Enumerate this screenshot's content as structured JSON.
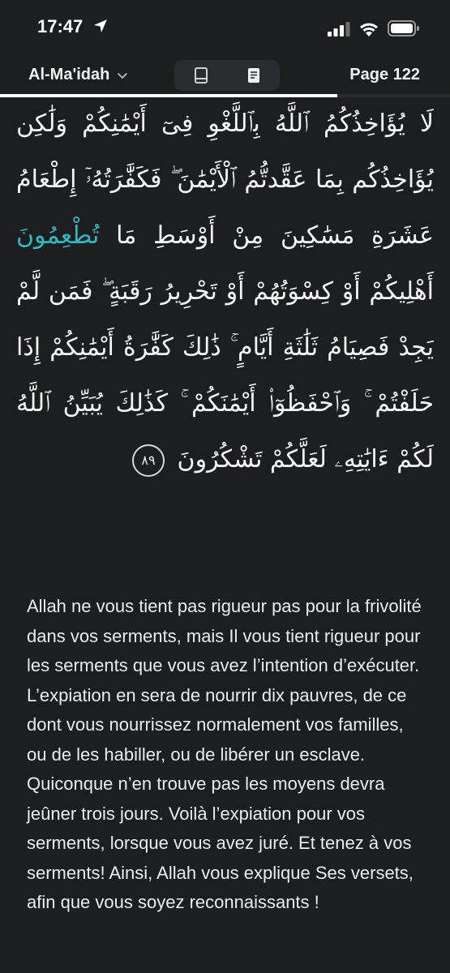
{
  "status_bar": {
    "time": "17:47"
  },
  "header": {
    "surah": "Al-Ma'idah",
    "page_label": "Page 122",
    "reading_progress": 0.75
  },
  "arabic": {
    "before_highlight": "لَا يُؤَاخِذُكُمُ ٱللَّهُ بِٱللَّغْوِ فِىٓ أَيْمَٰنِكُمْ وَلَٰكِن يُؤَاخِذُكُم بِمَا عَقَّدتُّمُ ٱلْأَيْمَٰنَ ۖ فَكَفَّٰرَتُهُۥٓ إِطْعَامُ عَشَرَةِ مَسَٰكِينَ مِنْ أَوْسَطِ مَا",
    "highlight": "تُطْعِمُونَ",
    "after_highlight": "أَهْلِيكُمْ أَوْ كِسْوَتُهُمْ أَوْ تَحْرِيرُ رَقَبَةٍ ۖ فَمَن لَّمْ يَجِدْ فَصِيَامُ ثَلَٰثَةِ أَيَّامٍ ۚ ذَٰلِكَ كَفَّٰرَةُ أَيْمَٰنِكُمْ إِذَا حَلَفْتُمْ ۚ وَٱحْفَظُوٓا۟ أَيْمَٰنَكُمْ ۚ كَذَٰلِكَ يُبَيِّنُ ٱللَّهُ لَكُمْ ءَايَٰتِهِۦ لَعَلَّكُمْ تَشْكُرُونَ",
    "ayah_number": "٨٩"
  },
  "translation": "Allah ne vous tient pas rigueur pas pour la frivolité dans vos serments, mais Il vous tient rigueur pour les serments que vous avez l’intention d’exécuter. L’expiation en sera de nourrir dix pauvres, de ce dont vous nourrissez normalement vos familles, ou de les habiller, ou de libérer un esclave. Quiconque n’en trouve pas les moyens devra jeûner trois jours. Voilà l’expiation pour vos serments, lorsque vous avez juré. Et tenez à vos serments! Ainsi, Allah vous explique Ses versets, afin que vous soyez reconnaissants !",
  "colors": {
    "background": "#1d1e20",
    "highlight": "#2eb8c0"
  },
  "icons": {
    "location": "location-arrow-icon",
    "signal": "cellular-signal-icon",
    "wifi": "wifi-icon",
    "battery": "battery-icon",
    "dropdown": "chevron-down-icon",
    "mushaf_view": "book-icon",
    "translation_view": "document-icon"
  }
}
